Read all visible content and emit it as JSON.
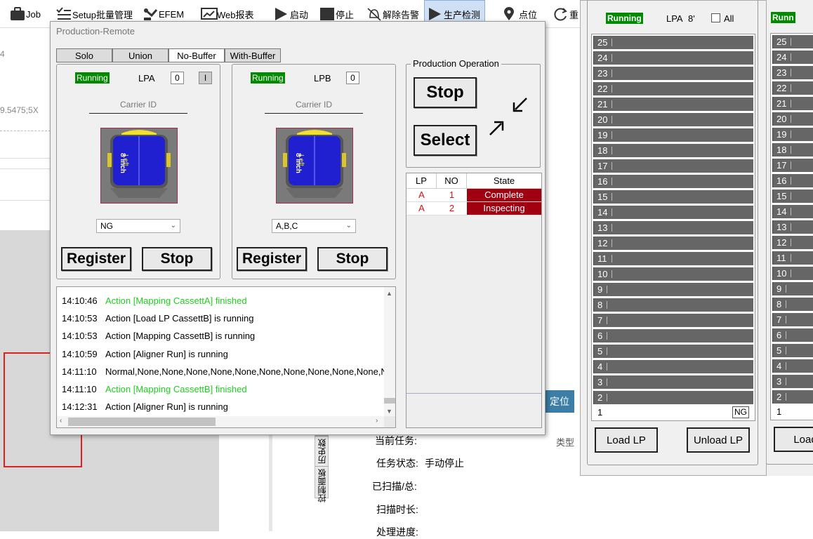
{
  "toolbar": {
    "items": [
      {
        "label": "Job",
        "icon": "briefcase-icon"
      },
      {
        "label": "Setup批量管理",
        "icon": "checklist-icon"
      },
      {
        "label": "EFEM",
        "icon": "robot-arm-icon"
      },
      {
        "label": "Web报表",
        "icon": "web-report-icon"
      },
      {
        "label": "启动",
        "icon": "play-icon"
      },
      {
        "label": "停止",
        "icon": "stop-square-icon"
      },
      {
        "label": "解除告警",
        "icon": "bell-off-icon"
      },
      {
        "label": "生产检测",
        "icon": "play-icon"
      },
      {
        "label": "点位",
        "icon": "location-pin-icon"
      },
      {
        "label": "重",
        "icon": "refresh-icon"
      }
    ]
  },
  "background": {
    "left_fragments": [
      "4",
      "9.5475;5X"
    ],
    "vertical_tabs": [
      "历史数",
      "控制面板"
    ],
    "task_labels": [
      "当前任务:",
      "任务状态:",
      "已扫描/总:",
      "扫描时长:",
      "处理进度:"
    ],
    "task_status_value": "手动停止",
    "locate_button": "定位",
    "type_label": "类型"
  },
  "remote": {
    "title": "Production-Remote",
    "tabs": [
      "Solo",
      "Union",
      "No-Buffer",
      "With-Buffer"
    ],
    "selected_tab": "No-Buffer",
    "lpa": {
      "status": "Running",
      "name": "LPA",
      "count": "0",
      "flag": "I",
      "carrier_label": "Carrier ID",
      "wafer_size": "8 inch",
      "wafer_side": "Left",
      "select_value": "NG",
      "register_label": "Register",
      "stop_label": "Stop"
    },
    "lpb": {
      "status": "Running",
      "name": "LPB",
      "count": "0",
      "carrier_label": "Carrier ID",
      "wafer_size": "8 inch",
      "wafer_side": "Left",
      "select_value": "A,B,C",
      "register_label": "Register",
      "stop_label": "Stop"
    },
    "production_operation": {
      "label": "Production Operation",
      "stop_label": "Stop",
      "select_label": "Select"
    },
    "state_table": {
      "headers": [
        "LP",
        "NO",
        "State"
      ],
      "rows": [
        {
          "lp": "A",
          "no": "1",
          "state": "Complete"
        },
        {
          "lp": "A",
          "no": "2",
          "state": "Inspecting"
        }
      ]
    },
    "log": [
      {
        "time": "14:10:46",
        "text": "Action [Mapping CassettA] finished",
        "color": "#22cc22"
      },
      {
        "time": "14:10:53",
        "text": "Action [Load LP CassettB] is running",
        "color": "#000000"
      },
      {
        "time": "14:10:53",
        "text": "Action [Mapping CassettB] is running",
        "color": "#000000"
      },
      {
        "time": "14:10:59",
        "text": "Action [Aligner Run] is running",
        "color": "#000000"
      },
      {
        "time": "14:11:10",
        "text": "Normal,None,None,None,None,None,None,None,None,None,None,N",
        "color": "#000000"
      },
      {
        "time": "14:11:10",
        "text": "Action [Mapping CassettB] finished",
        "color": "#22cc22"
      },
      {
        "time": "14:12:31",
        "text": "Action [Aligner Run] is running",
        "color": "#000000"
      }
    ]
  },
  "slot_panel_a": {
    "status": "Running",
    "name": "LPA",
    "size": "8'",
    "all_label": "All",
    "slots": [
      "25",
      "24",
      "23",
      "22",
      "21",
      "20",
      "19",
      "18",
      "17",
      "16",
      "15",
      "14",
      "13",
      "12",
      "11",
      "10",
      "9",
      "8",
      "7",
      "6",
      "5",
      "4",
      "3",
      "2"
    ],
    "slot1": {
      "num": "1",
      "tag": "NG"
    },
    "load_label": "Load LP",
    "unload_label": "Unload LP"
  },
  "slot_panel_b": {
    "status": "Runn",
    "slots": [
      "25",
      "24",
      "23",
      "22",
      "21",
      "20",
      "19",
      "18",
      "17",
      "16",
      "15",
      "14",
      "13",
      "12",
      "11",
      "10",
      "9",
      "8",
      "7",
      "6",
      "5",
      "4",
      "3",
      "2"
    ],
    "slot1": {
      "num": "1"
    },
    "load_label": "Load"
  },
  "colors": {
    "running": "#008a00",
    "complete_bg": "#a00010",
    "error_text": "#e01010",
    "slot_fill": "#666666",
    "log_green": "#22cc22"
  }
}
